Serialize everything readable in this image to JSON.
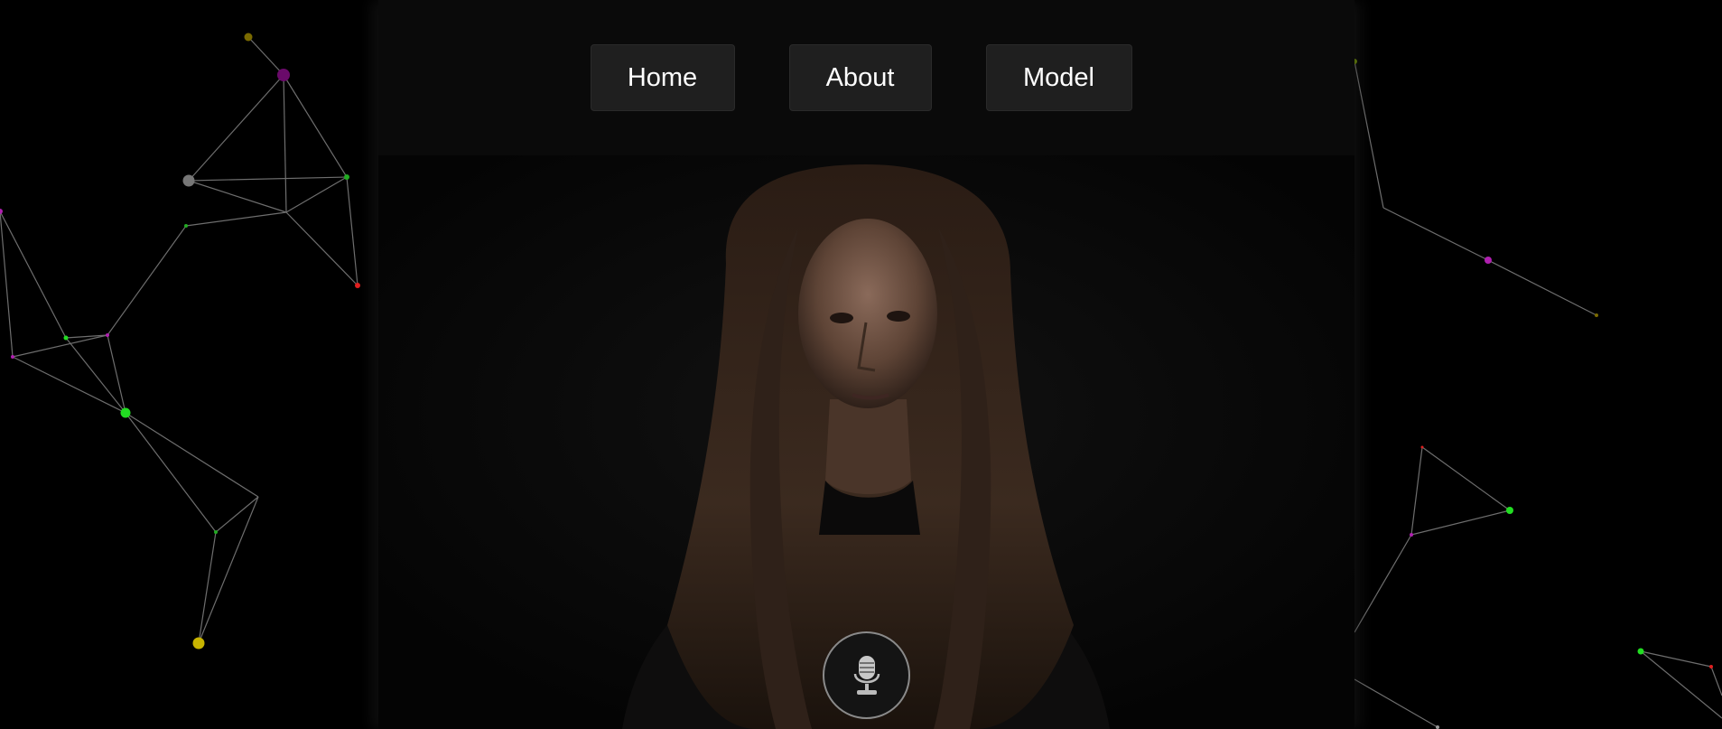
{
  "nav": {
    "items": [
      {
        "label": "Home"
      },
      {
        "label": "About"
      },
      {
        "label": "Model"
      }
    ]
  },
  "colors": {
    "background": "#000000",
    "panel": "#080808",
    "button": "#1f1f1f",
    "button_text": "#ffffff",
    "node_green": "#22dd22",
    "node_purple": "#b020b0",
    "node_yellow": "#c8b400",
    "node_red": "#e02020",
    "node_gray": "#777777",
    "link": "#8a8a8a"
  },
  "icons": {
    "mic": "microphone-icon"
  }
}
